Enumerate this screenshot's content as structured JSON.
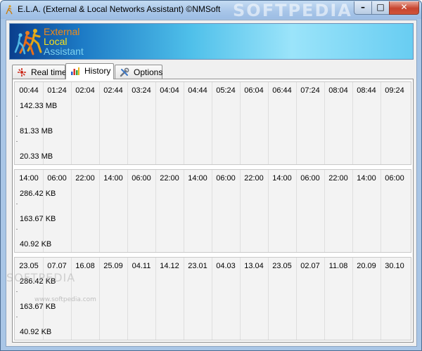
{
  "window": {
    "title": "E.L.A. (External & Local Networks Assistant) ©NMSoft",
    "watermark": "SOFTPEDIA",
    "controls": {
      "minimize": "–",
      "maximize": "□",
      "close": "✕"
    },
    "icon": "app-runner-icon"
  },
  "banner": {
    "line1": "External",
    "line2": "Local",
    "line3": "Assistant",
    "colors": {
      "external": "#f08a18",
      "local": "#f6e21a",
      "assistant": "#7ed2ee"
    }
  },
  "tabs": [
    {
      "label": "Real time",
      "icon": "realtime-icon",
      "active": false
    },
    {
      "label": "History",
      "icon": "history-icon",
      "active": true
    },
    {
      "label": "Options",
      "icon": "options-icon",
      "active": false
    }
  ],
  "graphs": [
    {
      "x_labels": [
        "00:44",
        "01:24",
        "02:04",
        "02:44",
        "03:24",
        "04:04",
        "04:44",
        "05:24",
        "06:04",
        "06:44",
        "07:24",
        "08:04",
        "08:44",
        "09:24"
      ],
      "y_labels": [
        "142.33 MB",
        "81.33 MB",
        "20.33 MB"
      ]
    },
    {
      "x_labels": [
        "14:00",
        "06:00",
        "22:00",
        "14:00",
        "06:00",
        "22:00",
        "14:00",
        "06:00",
        "22:00",
        "14:00",
        "06:00",
        "22:00",
        "14:00",
        "06:00"
      ],
      "y_labels": [
        "286.42 KB",
        "163.67 KB",
        "40.92 KB"
      ]
    },
    {
      "x_labels": [
        "23.05",
        "07.07",
        "16.08",
        "25.09",
        "04.11",
        "14.12",
        "23.01",
        "04.03",
        "13.04",
        "23.05",
        "02.07",
        "11.08",
        "20.09",
        "30.10"
      ],
      "y_labels": [
        "286.42 KB",
        "163.67 KB",
        "40.92 KB"
      ]
    }
  ],
  "body_watermark": "SOFTPEDIA",
  "body_watermark_url": "www.softpedia.com"
}
